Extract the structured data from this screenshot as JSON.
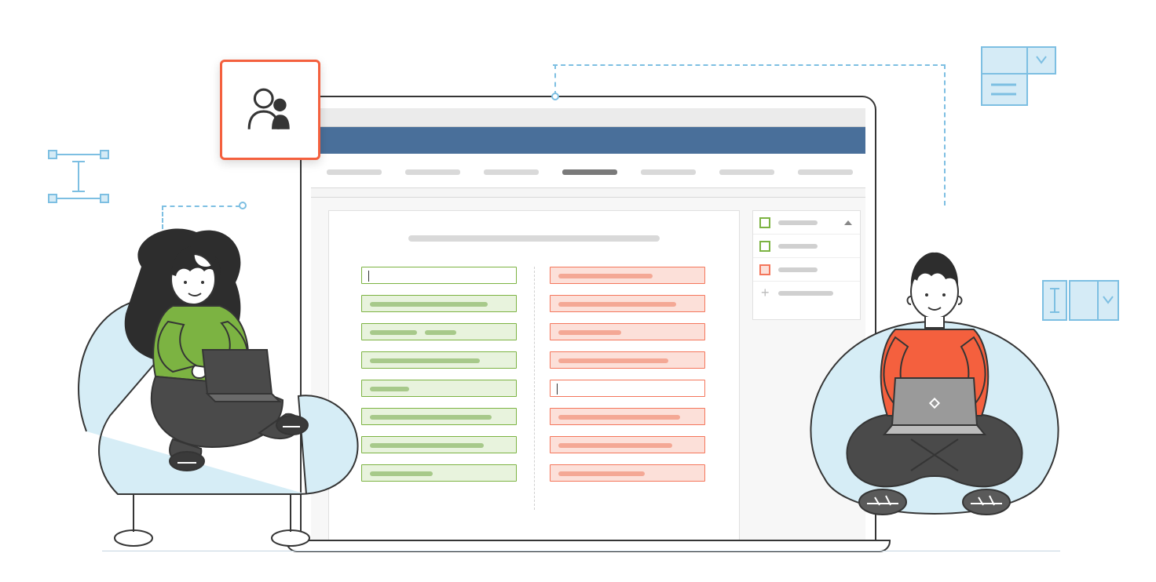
{
  "scene": {
    "description": "Illustration of two people collaborating, each on a laptop, flanking a large laptop mockup showing a two-column editing interface",
    "accent_orange": "#f4603e",
    "accent_blue": "#7dbfe2",
    "accent_green": "#7cb342",
    "accent_navy": "#496f9a"
  },
  "badge": {
    "icon": "people-group-icon"
  },
  "app": {
    "tabs": [
      false,
      false,
      false,
      true,
      false,
      false,
      false
    ],
    "left_column_color": "green",
    "right_column_color": "orange",
    "left_rows": 8,
    "right_rows": 8,
    "side_items": [
      {
        "color": "#7cb342",
        "expanded": true
      },
      {
        "color": "#7cb342",
        "expanded": false
      },
      {
        "color": "#f4765b",
        "expanded": false
      },
      {
        "color": null,
        "add": true
      }
    ]
  }
}
